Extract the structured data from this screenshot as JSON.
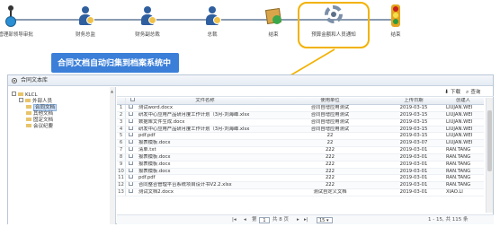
{
  "workflow": {
    "steps": [
      {
        "label": "财务管理部领导审批",
        "icon": "start-node-icon"
      },
      {
        "label": "财务总监",
        "icon": "person-icon"
      },
      {
        "label": "财务副总裁",
        "icon": "person-icon"
      },
      {
        "label": "总裁",
        "icon": "person-icon"
      },
      {
        "label": "结束",
        "icon": "package-check-icon"
      },
      {
        "label": "预算金额和人员通知",
        "icon": "gear-icon"
      },
      {
        "label": "结束",
        "icon": "traffic-light-icon"
      }
    ],
    "highlight_color": "#f2b200"
  },
  "callout": {
    "text": "合同文档自动归集到档案系统中",
    "color": "#3b7fd9"
  },
  "panel": {
    "title": "合同文本库",
    "toolbar": {
      "download_label": "下载",
      "download_icon": "download-icon",
      "query_label": "查询",
      "query_icon": "search-icon"
    },
    "tree": {
      "items": [
        {
          "label": "KLCL",
          "level": 0
        },
        {
          "label": "外部人员",
          "level": 1
        },
        {
          "label": "合同文档",
          "level": 2,
          "selected": true
        },
        {
          "label": "其他文档",
          "level": 2
        },
        {
          "label": "固定文档",
          "level": 2
        },
        {
          "label": "会议纪要",
          "level": 2
        }
      ]
    },
    "grid": {
      "columns": [
        "",
        "文件名称",
        "使用单位",
        "上传日期",
        "创建人"
      ],
      "rows": [
        {
          "no": "1",
          "name": "测试word.docx",
          "user": "合同自增应用测试",
          "date": "2019-03-15",
          "creator": "LIUJAN.WEI"
        },
        {
          "no": "2",
          "name": "研发中心应用产品研月度工作计划（3月-刘海峰.xlsx",
          "user": "合同自增应用测试",
          "date": "2019-03-15",
          "creator": "LIUJAN.WEI"
        },
        {
          "no": "3",
          "name": "数据库文件生成.docx",
          "user": "合同自增应用测试",
          "date": "2019-03-15",
          "creator": "LIUJAN.WEI"
        },
        {
          "no": "4",
          "name": "研发中心应用产品研月度工作计划（3月-刘海峰.xlsx",
          "user": "合同自增应用测试",
          "date": "2019-03-15",
          "creator": "LIUJAN.WEI"
        },
        {
          "no": "5",
          "name": "pdf.pdf",
          "user": "22",
          "date": "2019-03-15",
          "creator": "LIUJAN.WEI"
        },
        {
          "no": "6",
          "name": "报表模板.docx",
          "user": "22",
          "date": "2019-03-07",
          "creator": "LIUJAN.WEI"
        },
        {
          "no": "7",
          "name": "清单.txt",
          "user": "222",
          "date": "2019-03-01",
          "creator": "RAN.TANG"
        },
        {
          "no": "8",
          "name": "报表模板.docx",
          "user": "222",
          "date": "2019-03-01",
          "creator": "RAN.TANG"
        },
        {
          "no": "9",
          "name": "报表模板.docx",
          "user": "222",
          "date": "2019-03-01",
          "creator": "RAN.TANG"
        },
        {
          "no": "10",
          "name": "报表模板.docx",
          "user": "222",
          "date": "2019-03-01",
          "creator": "RAN.TANG"
        },
        {
          "no": "11",
          "name": "pdf.pdf",
          "user": "222",
          "date": "2019-03-01",
          "creator": "RAN.TANG"
        },
        {
          "no": "12",
          "name": "合同整合管理平台系统项目设计书V2.2.xlsx",
          "user": "222",
          "date": "2019-03-01",
          "creator": "RAN.TANG"
        },
        {
          "no": "13",
          "name": "测试文档2.docx",
          "user": "测试自定义文档",
          "date": "2019-03-01",
          "creator": "XIAO.LI"
        }
      ]
    },
    "pager": {
      "first": "|◂",
      "prev": "◂",
      "page_prefix": "第",
      "page": "1",
      "page_suffix": "共 8 页",
      "next": "▸",
      "last": "▸|",
      "page_size": "15",
      "summary": "1 - 15, 共 115 条"
    }
  }
}
